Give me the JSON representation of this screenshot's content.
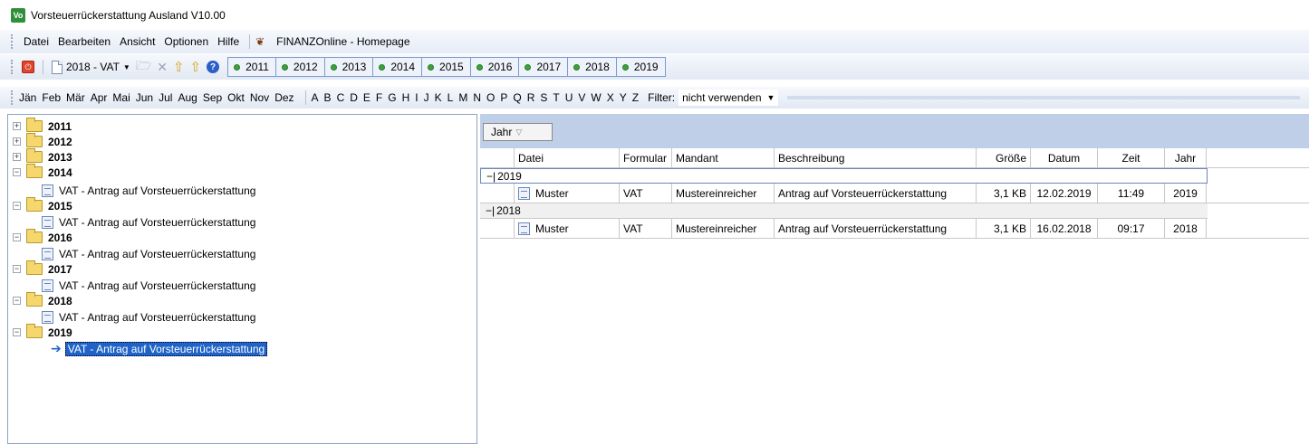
{
  "window": {
    "title": "Vorsteuerrückerstattung Ausland V10.00",
    "app_icon_text": "Vo"
  },
  "menu": {
    "items": [
      {
        "label": "Datei"
      },
      {
        "label": "Bearbeiten"
      },
      {
        "label": "Ansicht"
      },
      {
        "label": "Optionen"
      },
      {
        "label": "Hilfe"
      }
    ],
    "finanzonline_label": "FINANZOnline - Homepage"
  },
  "toolbar": {
    "new_label": "2018 - VAT",
    "years": [
      "2011",
      "2012",
      "2013",
      "2014",
      "2015",
      "2016",
      "2017",
      "2018",
      "2019"
    ]
  },
  "filterbar": {
    "months": [
      "Jän",
      "Feb",
      "Mär",
      "Apr",
      "Mai",
      "Jun",
      "Jul",
      "Aug",
      "Sep",
      "Okt",
      "Nov",
      "Dez"
    ],
    "letters": [
      "A",
      "B",
      "C",
      "D",
      "E",
      "F",
      "G",
      "H",
      "I",
      "J",
      "K",
      "L",
      "M",
      "N",
      "O",
      "P",
      "Q",
      "R",
      "S",
      "T",
      "U",
      "V",
      "W",
      "X",
      "Y",
      "Z"
    ],
    "filter_label": "Filter:",
    "filter_value": "nicht verwenden"
  },
  "tree": {
    "collapsed": [
      "2011",
      "2012",
      "2013"
    ],
    "expanded": [
      {
        "year": "2014",
        "item": "VAT - Antrag auf Vorsteuerrückerstattung"
      },
      {
        "year": "2015",
        "item": "VAT - Antrag auf Vorsteuerrückerstattung"
      },
      {
        "year": "2016",
        "item": "VAT - Antrag auf Vorsteuerrückerstattung"
      },
      {
        "year": "2017",
        "item": "VAT - Antrag auf Vorsteuerrückerstattung"
      },
      {
        "year": "2018",
        "item": "VAT - Antrag auf Vorsteuerrückerstattung"
      },
      {
        "year": "2019",
        "item": "VAT - Antrag auf Vorsteuerrückerstattung"
      }
    ]
  },
  "grid": {
    "group_by": "Jahr",
    "columns": [
      "Datei",
      "Formular",
      "Mandant",
      "Beschreibung",
      "Größe",
      "Datum",
      "Zeit",
      "Jahr"
    ],
    "groups": [
      {
        "label": "2019",
        "rows": [
          {
            "datei": "Muster",
            "formular": "VAT",
            "mandant": "Mustereinreicher",
            "beschreibung": "Antrag auf Vorsteuerrückerstattung",
            "groesse": "3,1 KB",
            "datum": "12.02.2019",
            "zeit": "11:49",
            "jahr": "2019"
          }
        ]
      },
      {
        "label": "2018",
        "rows": [
          {
            "datei": "Muster",
            "formular": "VAT",
            "mandant": "Mustereinreicher",
            "beschreibung": "Antrag auf Vorsteuerrückerstattung",
            "groesse": "3,1 KB",
            "datum": "16.02.2018",
            "zeit": "09:17",
            "jahr": "2018"
          }
        ]
      }
    ]
  },
  "colors": {
    "accent": "#1f63c9",
    "group_area": "#bfcfe8",
    "toolbar_border": "#7a9bcc"
  }
}
